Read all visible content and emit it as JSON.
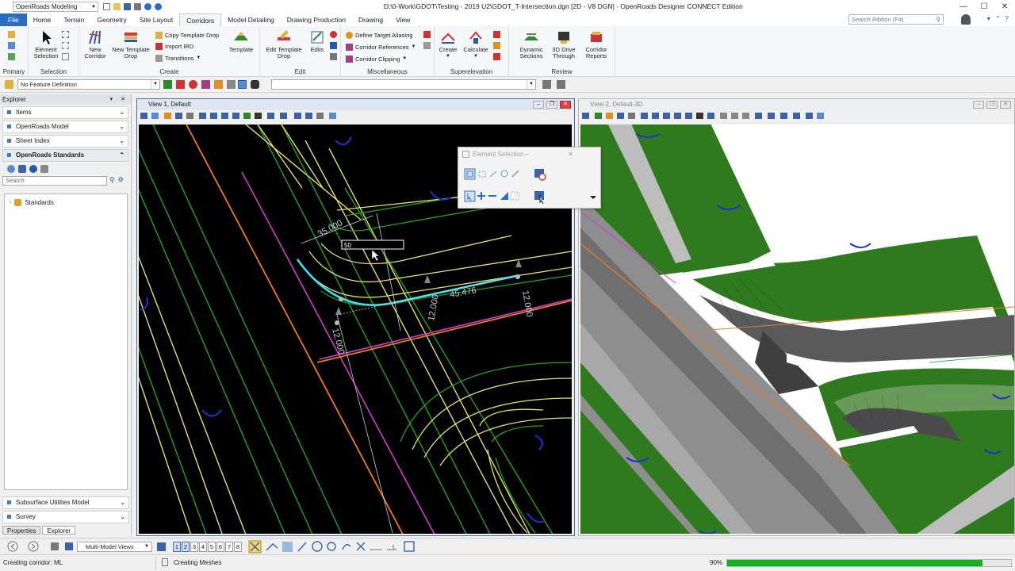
{
  "titlebar": {
    "workspace": "OpenRoads Modeling",
    "title": "D:\\0-Work\\GDOT\\Testing - 2019 U2\\GDOT_T-Intersection.dgn [2D - V8 DGN] - OpenRoads Designer CONNECT Edition"
  },
  "tabs": [
    "File",
    "Home",
    "Terrain",
    "Geometry",
    "Site Layout",
    "Corridors",
    "Model Detailing",
    "Drawing Production",
    "Drawing",
    "View"
  ],
  "active_tab": "Corridors",
  "ribbon_search_placeholder": "Search Ribbon (F4)",
  "ribbon": {
    "groups": {
      "primary": "Primary",
      "selection": "Selection",
      "create": "Create",
      "edit": "Edit",
      "misc": "Miscellaneous",
      "super": "Superelevation",
      "review": "Review"
    },
    "element_selection": "Element Selection",
    "new_corridor": "New Corridor",
    "new_template_drop": "New Template Drop",
    "copy_template_drop": "Copy Template Drop",
    "import_ird": "Import IRD",
    "transitions": "Transitions",
    "template": "Template",
    "edit_template_drop": "Edit Template Drop",
    "edits": "Edits",
    "define_target_aliasing": "Define Target Aliasing",
    "corridor_references": "Corridor References",
    "corridor_clipping": "Corridor Clipping",
    "create": "Create",
    "calculate": "Calculate",
    "dynamic_sections": "Dynamic Sections",
    "drive_through": "3D Drive Through",
    "corridor_reports": "Corridor Reports"
  },
  "attrbar": {
    "feature_definition": "No Feature Definition"
  },
  "explorer": {
    "title": "Explorer",
    "sections": [
      "Items",
      "OpenRoads Model",
      "Sheet Index",
      "OpenRoads Standards"
    ],
    "search_placeholder": "Search",
    "tree_root": "Standards",
    "lower_sections": [
      "Subsurface Utilities Model",
      "Survey"
    ],
    "bottom_tabs": [
      "Properties",
      "Explorer"
    ]
  },
  "view1": {
    "title": "View 1, Default",
    "labels": {
      "dim1": "35.000",
      "dim2": "45.476",
      "dim3": "12.000",
      "dim4": "12.000",
      "dim5": "12.000",
      "input": "50"
    }
  },
  "view2": {
    "title": "View 2, Default-3D"
  },
  "element_selection_dialog": {
    "title": "Element Selection"
  },
  "bottombar": {
    "view_mode": "Multi-Model Views",
    "view_numbers": [
      "1",
      "2",
      "3",
      "4",
      "5",
      "6",
      "7",
      "8"
    ]
  },
  "status": {
    "left": "Creating corridor: ML",
    "middle": "Creating Meshes",
    "percent_label": "90%",
    "progress": 0.9
  },
  "colors": {
    "file_tab": "#2b6cc4",
    "canvas_bg": "#000000",
    "progress": "#13b024",
    "road_green": "#1fa51f",
    "yellow_line": "#e4e26a",
    "orange_line": "#f07a1f",
    "magenta_line": "#d43ad4",
    "cyan_curve": "#3fe0f0"
  }
}
